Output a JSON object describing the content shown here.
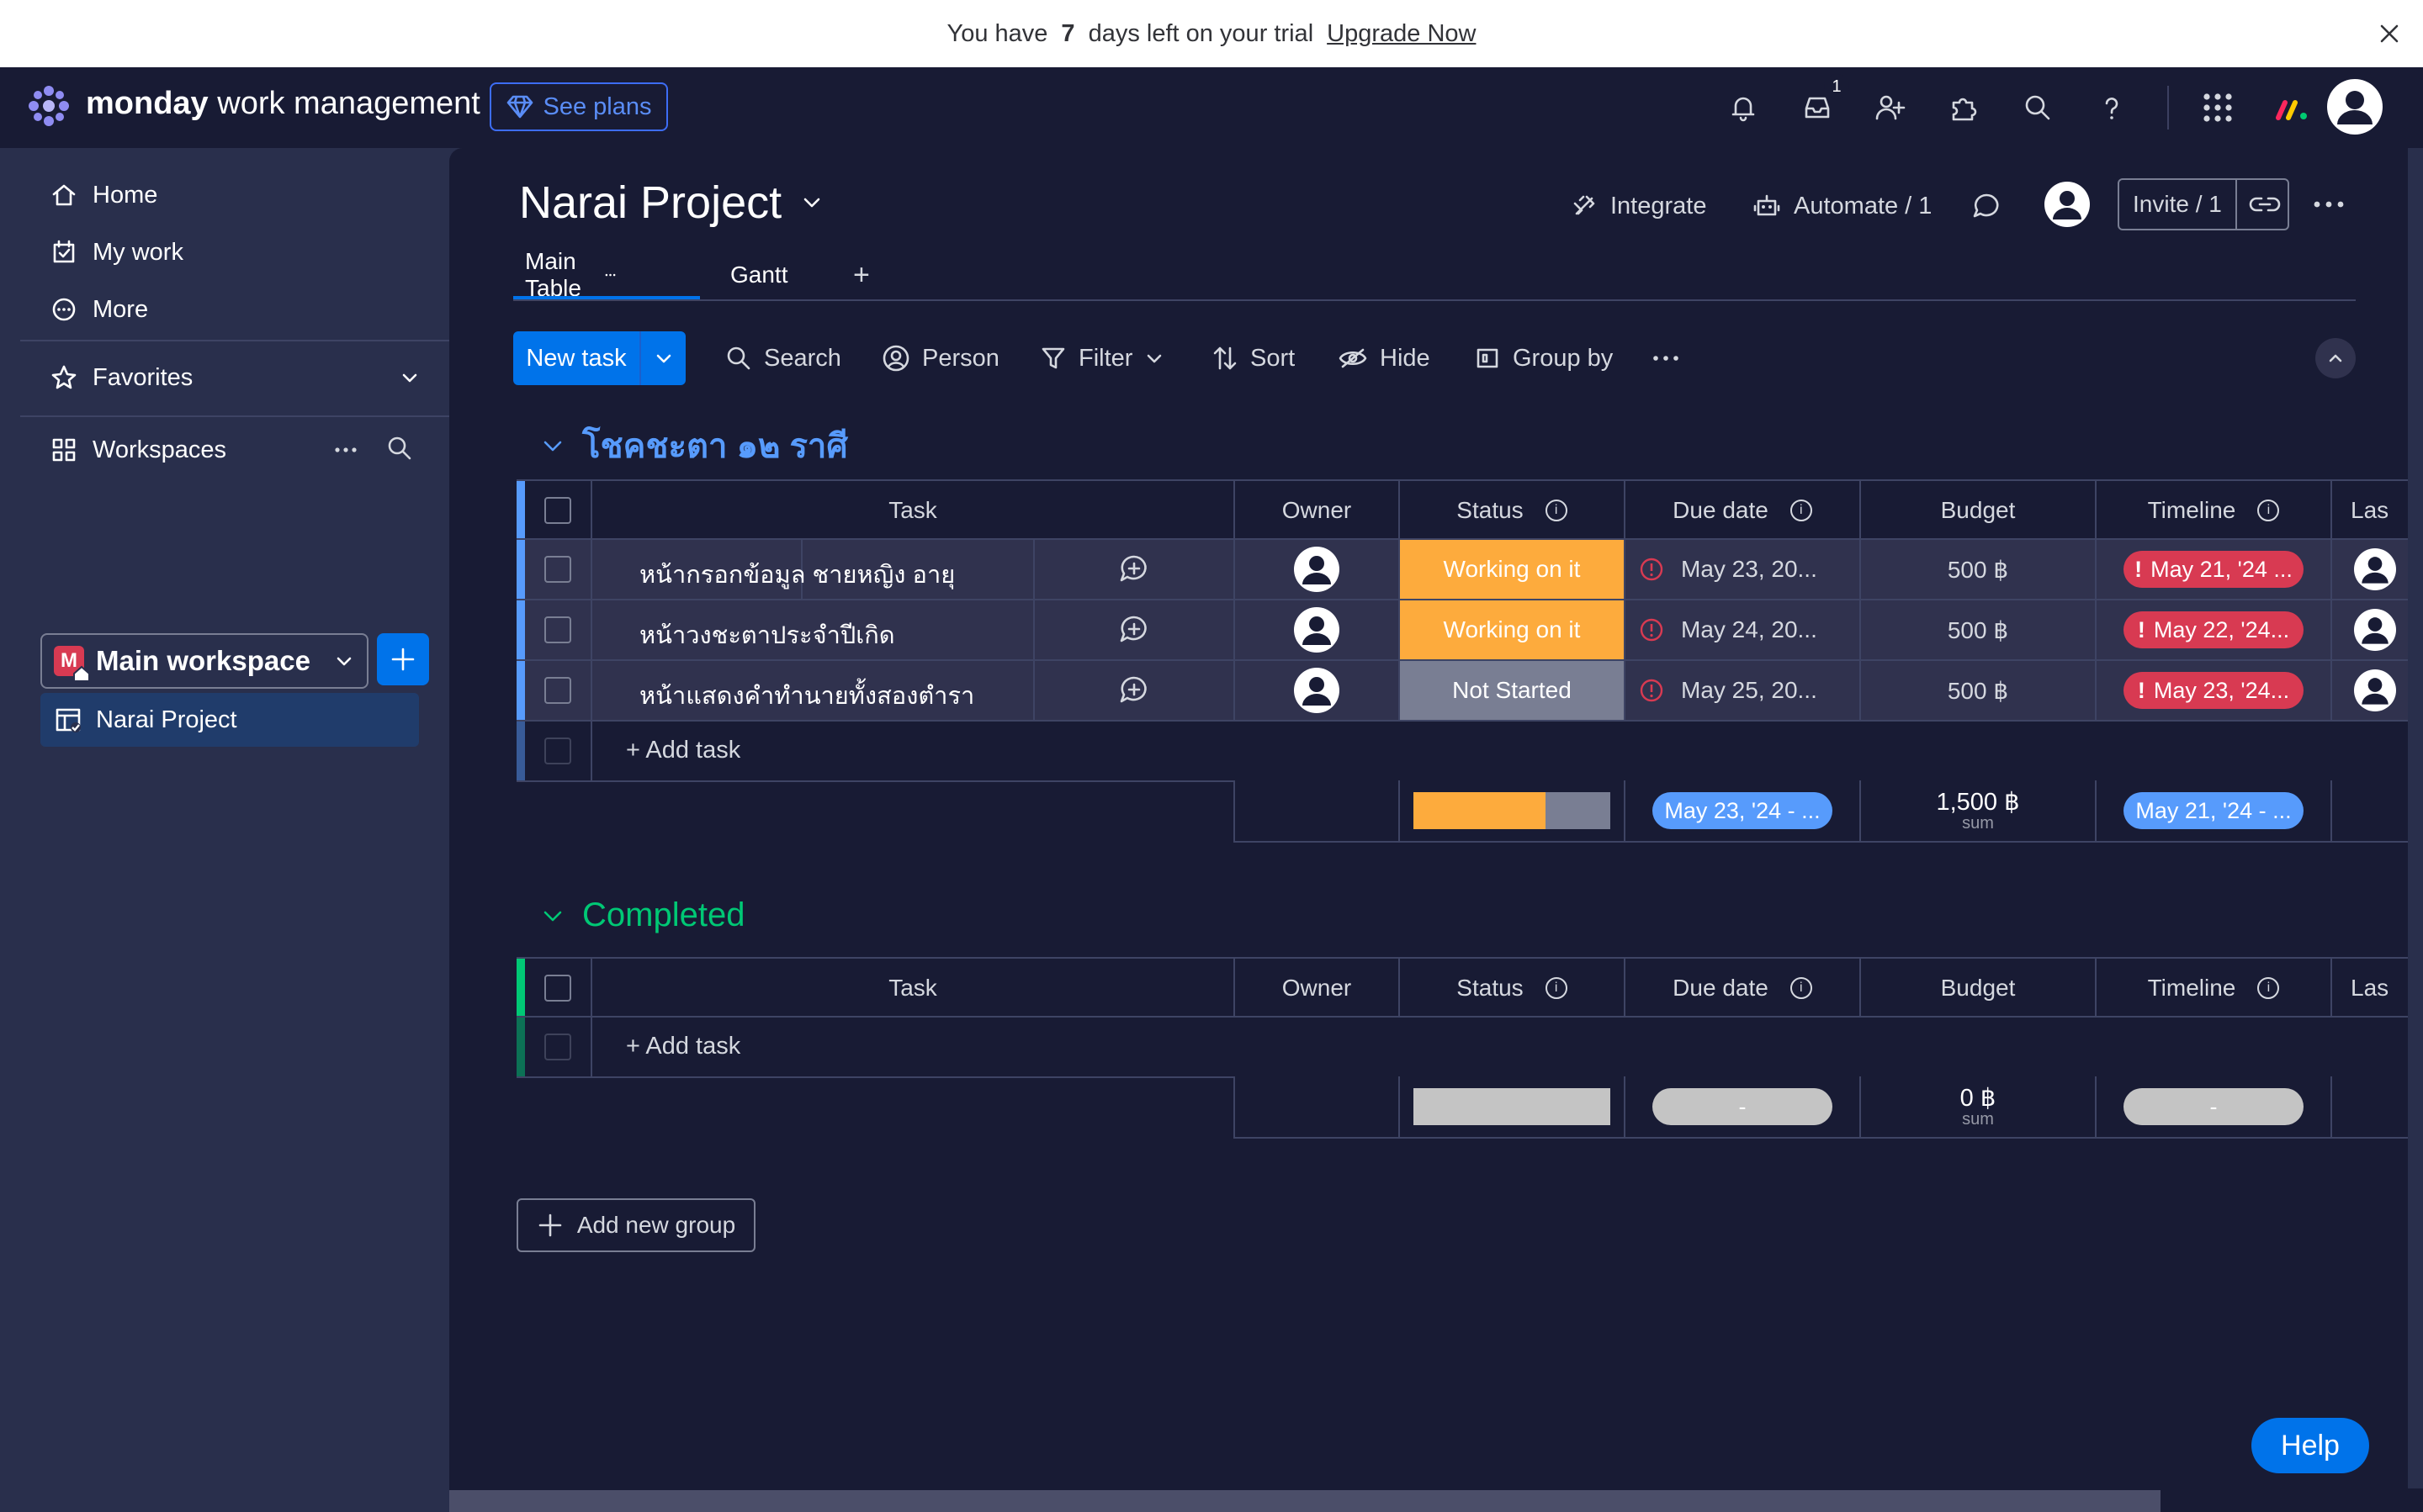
{
  "banner": {
    "prefix": "You have",
    "days": "7",
    "suffix": "days left on your trial",
    "link": "Upgrade Now"
  },
  "header": {
    "brand_bold": "monday",
    "brand_rest": "work management",
    "see_plans": "See plans",
    "inbox_badge": "1",
    "icons": [
      "bell-icon",
      "inbox-icon",
      "invite-members-icon",
      "apps-icon",
      "search-icon",
      "help-icon",
      "app-grid-icon"
    ]
  },
  "sidebar": {
    "nav": [
      {
        "label": "Home",
        "icon": "home-icon"
      },
      {
        "label": "My work",
        "icon": "calendar-check-icon"
      },
      {
        "label": "More",
        "icon": "more-icon"
      }
    ],
    "favorites": "Favorites",
    "workspaces": "Workspaces",
    "workspace_initial": "M",
    "workspace_name": "Main workspace",
    "board": "Narai Project"
  },
  "board": {
    "title": "Narai Project",
    "integrate": "Integrate",
    "automate": "Automate / 1",
    "invite": "Invite / 1",
    "tabs": [
      {
        "label": "Main Table"
      },
      {
        "label": "Gantt"
      }
    ],
    "add_tab": "+"
  },
  "toolbar": {
    "new_task": "New task",
    "search": "Search",
    "person": "Person",
    "filter": "Filter",
    "sort": "Sort",
    "hide": "Hide",
    "group_by": "Group by"
  },
  "columns": {
    "task": "Task",
    "owner": "Owner",
    "status": "Status",
    "due": "Due date",
    "budget": "Budget",
    "timeline": "Timeline",
    "last": "Las"
  },
  "groups": [
    {
      "title": "โชคชะตา ๑๒ ราศี",
      "color": "#579bfc",
      "rows": [
        {
          "task": "หน้ากรอกข้อมูล ชายหญิง อายุ",
          "status": "Working on it",
          "status_color": "#fdab3d",
          "due": "May 23, 20...",
          "budget": "500 ฿",
          "timeline": "May 21, '24 ..."
        },
        {
          "task": "หน้าวงชะตาประจำปีเกิด",
          "status": "Working on it",
          "status_color": "#fdab3d",
          "due": "May 24, 20...",
          "budget": "500 ฿",
          "timeline": "May 22, '24..."
        },
        {
          "task": "หน้าแสดงคำทำนายทั้งสองตำรา",
          "status": "Not Started",
          "status_color": "#797e93",
          "due": "May 25, 20...",
          "budget": "500 ฿",
          "timeline": "May 23, '24..."
        }
      ],
      "add_task": "+ Add task",
      "summary": {
        "due": "May 23, '24 - ...",
        "budget": "1,500 ฿",
        "budget_label": "sum",
        "timeline": "May 21, '24 - ...",
        "status_dist": [
          {
            "color": "#fdab3d",
            "share": 0.67
          },
          {
            "color": "#797e93",
            "share": 0.33
          }
        ]
      }
    },
    {
      "title": "Completed",
      "color": "#00c875",
      "rows": [],
      "add_task": "+ Add task",
      "summary": {
        "due": "-",
        "budget": "0 ฿",
        "budget_label": "sum",
        "timeline": "-"
      }
    }
  ],
  "add_group": "Add new group",
  "help": "Help"
}
